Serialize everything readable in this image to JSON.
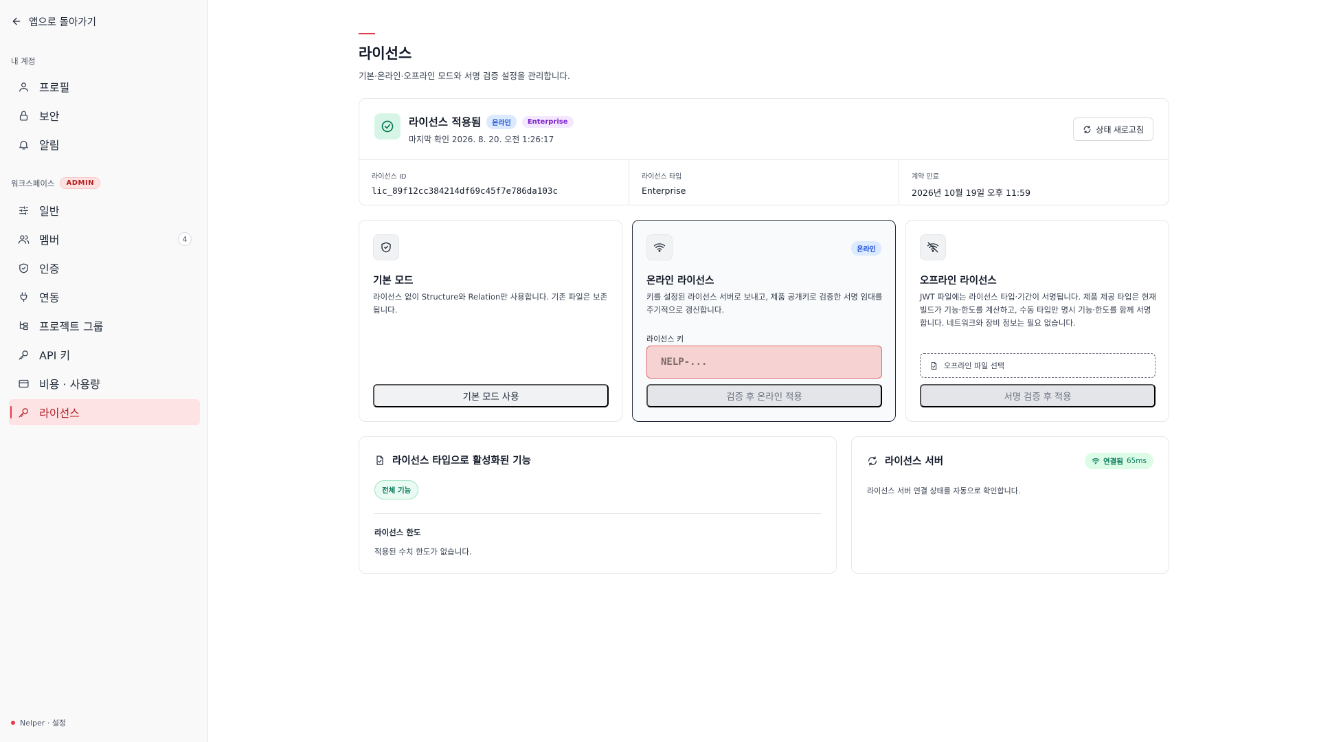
{
  "sidebar": {
    "back_label": "앱으로 돌아가기",
    "account_section": "내 계정",
    "account_items": [
      {
        "label": "프로필",
        "icon": "user-icon"
      },
      {
        "label": "보안",
        "icon": "lock-icon"
      },
      {
        "label": "알림",
        "icon": "bell-icon"
      }
    ],
    "workspace_section": "워크스페이스",
    "workspace_badge": "ADMIN",
    "workspace_items": [
      {
        "label": "일반",
        "icon": "sliders-icon"
      },
      {
        "label": "멤버",
        "icon": "users-icon",
        "count": "4"
      },
      {
        "label": "인증",
        "icon": "shield-check-icon"
      },
      {
        "label": "연동",
        "icon": "plug-icon"
      },
      {
        "label": "프로젝트 그룹",
        "icon": "tree-icon"
      },
      {
        "label": "API 키",
        "icon": "key-icon"
      },
      {
        "label": "비용 · 사용량",
        "icon": "credit-card-icon"
      },
      {
        "label": "라이선스",
        "icon": "key-icon",
        "active": true
      }
    ],
    "footer": "Nelper · 설정"
  },
  "page": {
    "title": "라이선스",
    "description": "기본·온라인·오프라인 모드와 서명 검증 설정을 관리합니다."
  },
  "status": {
    "title": "라이선스 적용됨",
    "badge_mode": "온라인",
    "badge_type": "Enterprise",
    "last_checked": "마지막 확인 2026. 8. 20. 오전 1:26:17",
    "refresh_label": "상태 새로고침",
    "info": [
      {
        "label": "라이선스 ID",
        "value": "lic_89f12cc384214df69c45f7e786da103c"
      },
      {
        "label": "라이선스 타입",
        "value": "Enterprise"
      },
      {
        "label": "계약 만료",
        "value": "2026년 10월 19일 오후 11:59"
      }
    ]
  },
  "modes": {
    "basic": {
      "title": "기본 모드",
      "description": "라이선스 없이 Structure와 Relation만 사용합니다. 기존 파일은 보존됩니다.",
      "button": "기본 모드 사용"
    },
    "online": {
      "title": "온라인 라이선스",
      "badge": "온라인",
      "description": "키를 설정된 라이선스 서버로 보내고, 제품 공개키로 검증한 서명 임대를 주기적으로 갱신합니다.",
      "key_label": "라이선스 키",
      "key_placeholder": "NELP-...",
      "button": "검증 후 온라인 적용"
    },
    "offline": {
      "title": "오프라인 라이선스",
      "description": "JWT 파일에는 라이선스 타입·기간이 서명됩니다. 제품 제공 타입은 현재 빌드가 기능·한도를 계산하고, 수동 타입만 명시 기능·한도를 함께 서명합니다. 네트워크와 장비 정보는 필요 없습니다.",
      "file_label": "오프라인 파일 선택",
      "button": "서명 검증 후 적용"
    }
  },
  "features": {
    "title": "라이선스 타입으로 활성화된 기능",
    "pill": "전체 기능",
    "limit_label": "라이선스 한도",
    "limit_desc": "적용된 수치 한도가 없습니다."
  },
  "server": {
    "title": "라이선스 서버",
    "status": "연결됨",
    "latency": "65ms",
    "description": "라이선스 서버 연결 상태를 자동으로 확인합니다."
  },
  "colors": {
    "accent": "#e53945",
    "success": "#10b981",
    "active_bg": "#fde3e3"
  }
}
